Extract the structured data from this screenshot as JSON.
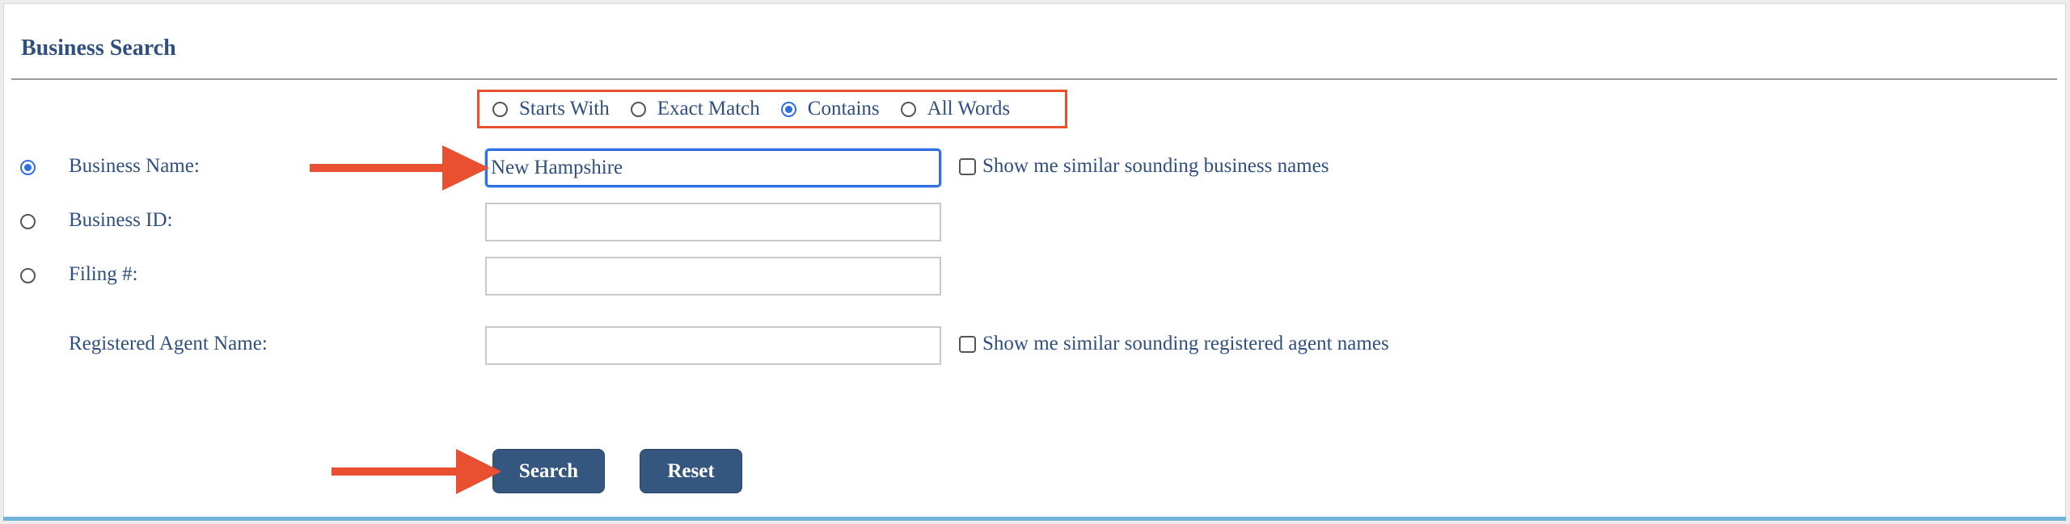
{
  "header": {
    "title": "Business Search"
  },
  "match_options": [
    {
      "label": "Starts With",
      "checked": false
    },
    {
      "label": "Exact Match",
      "checked": false
    },
    {
      "label": "Contains",
      "checked": true
    },
    {
      "label": "All Words",
      "checked": false
    }
  ],
  "fields": {
    "business_name": {
      "label": "Business Name:",
      "value": "New Hampshire",
      "selected": true
    },
    "business_id": {
      "label": "Business ID:",
      "value": "",
      "selected": false
    },
    "filing_number": {
      "label": "Filing #:",
      "value": "",
      "selected": false
    },
    "registered_agent": {
      "label": "Registered Agent Name:",
      "value": ""
    }
  },
  "checkboxes": {
    "similar_business": {
      "label": "Show me similar sounding business names",
      "checked": false
    },
    "similar_agent": {
      "label": "Show me similar sounding registered agent names",
      "checked": false
    }
  },
  "buttons": {
    "search": "Search",
    "reset": "Reset"
  },
  "colors": {
    "text": "#2f4f7f",
    "button_bg": "#35577f",
    "annotation": "#e8502f",
    "focus": "#2f6fe0",
    "bottom_strip": "#6fb3d8"
  },
  "icons": [
    "radio-button",
    "checkbox",
    "annotation-arrow-icon"
  ]
}
